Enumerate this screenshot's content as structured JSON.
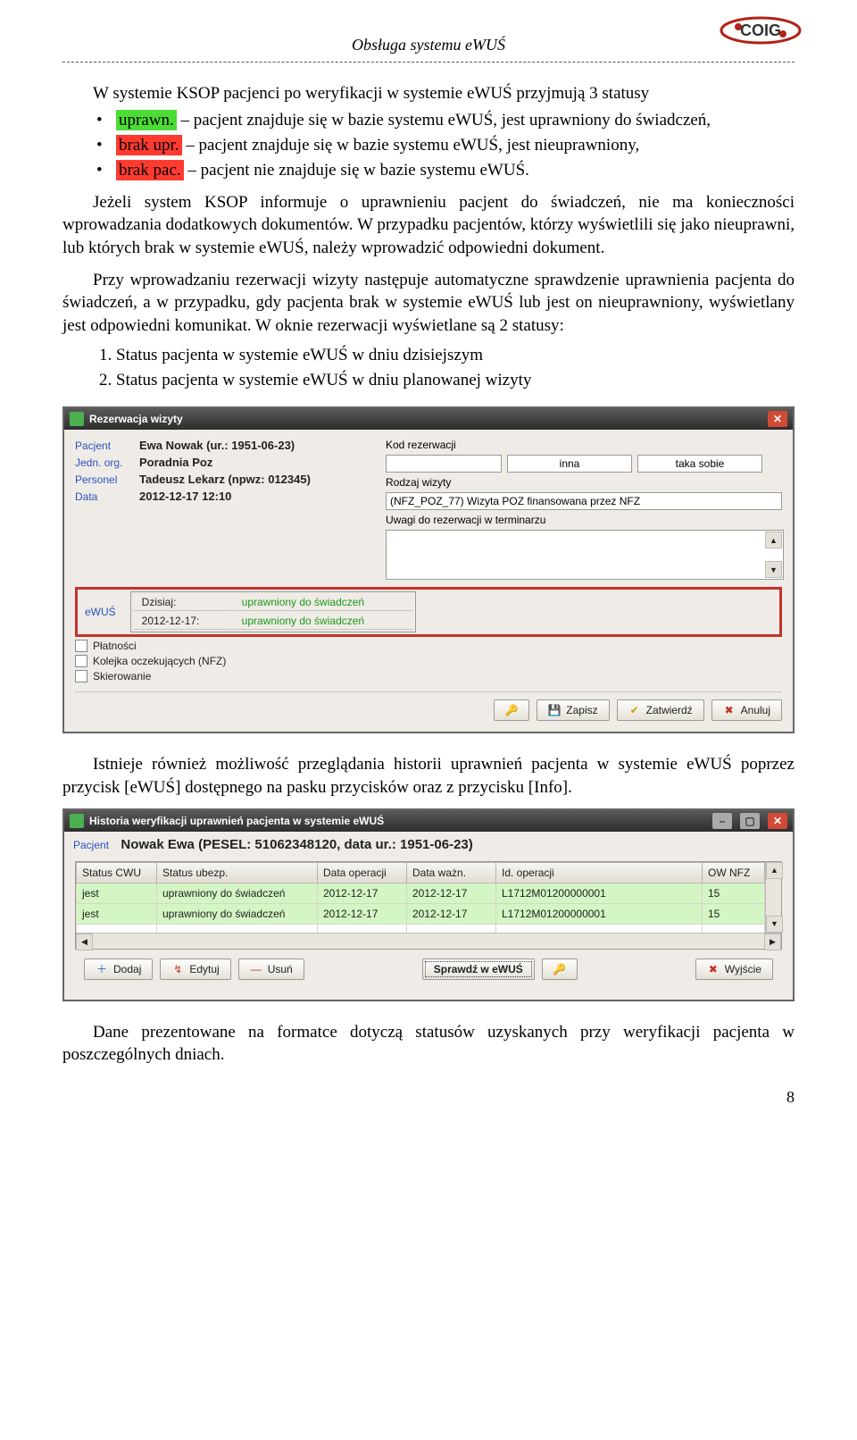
{
  "header": {
    "title": "Obsługa systemu eWUŚ",
    "logo_alt": "COIG"
  },
  "text": {
    "p1_a": "W systemie KSOP pacjenci po weryfikacji w systemie eWUŚ przyjmują 3 statusy",
    "b1_tag": "uprawn.",
    "b1_rest": " – pacjent znajduje się w bazie systemu eWUŚ, jest uprawniony do świadczeń,",
    "b2_tag": "brak upr.",
    "b2_rest": " – pacjent znajduje się w bazie systemu eWUŚ, jest nieuprawniony,",
    "b3_tag": "brak pac.",
    "b3_rest": " – pacjent nie znajduje się w bazie systemu eWUŚ.",
    "p2": "Jeżeli system KSOP informuje o uprawnieniu pacjent do świadczeń, nie ma konieczności wprowadzania dodatkowych dokumentów. W przypadku pacjentów, którzy wyświetlili się jako nieuprawni, lub których brak w systemie eWUŚ, należy wprowadzić odpowiedni dokument.",
    "p3": "Przy wprowadzaniu rezerwacji wizyty następuje automatyczne sprawdzenie uprawnienia pacjenta do świadczeń, a w przypadku, gdy pacjenta brak w systemie eWUŚ lub jest on nieuprawniony, wyświetlany jest odpowiedni komunikat. W oknie rezerwacji wyświetlane są 2 statusy:",
    "n1": "Status pacjenta w systemie eWUŚ w dniu dzisiejszym",
    "n2": "Status pacjenta w systemie eWUŚ w dniu planowanej wizyty",
    "p4": "Istnieje również możliwość przeglądania historii uprawnień pacjenta w systemie eWUŚ poprzez przycisk [eWUŚ] dostępnego na pasku przycisków oraz z przycisku [Info].",
    "p5": "Dane prezentowane na formatce dotyczą statusów uzyskanych przy weryfikacji pacjenta w poszczególnych dniach.",
    "pagenum": "8"
  },
  "win1": {
    "title": "Rezerwacja wizyty",
    "left": {
      "lbl_pacjent": "Pacjent",
      "val_pacjent": "Ewa Nowak (ur.: 1951-06-23)",
      "lbl_jedn": "Jedn. org.",
      "val_jedn": "Poradnia Poz",
      "lbl_personel": "Personel",
      "val_personel": "Tadeusz Lekarz (npwz: 012345)",
      "lbl_data": "Data",
      "val_data": "2012-12-17 12:10"
    },
    "right": {
      "lbl_kod": "Kod rezerwacji",
      "kod_val": "",
      "inna_val": "inna",
      "taka_val": "taka sobie",
      "lbl_rodzaj": "Rodzaj wizyty",
      "rodzaj_val": "(NFZ_POZ_77) Wizyta POZ finansowana przez NFZ",
      "lbl_uwagi": "Uwagi do rezerwacji w terminarzu"
    },
    "ewus": {
      "label": "eWUŚ",
      "row1_l": "Dzisiaj:",
      "row1_v": "uprawniony do świadczeń",
      "row2_l": "2012-12-17:",
      "row2_v": "uprawniony do świadczeń"
    },
    "chk": {
      "platnosci": "Płatności",
      "kolejka": "Kolejka oczekujących (NFZ)",
      "skierowanie": "Skierowanie"
    },
    "btn": {
      "zapisz": "Zapisz",
      "zatwierdz": "Zatwierdź",
      "anuluj": "Anuluj"
    }
  },
  "win2": {
    "title": "Historia weryfikacji uprawnień pacjenta w systemie eWUŚ",
    "lbl_pacjent": "Pacjent",
    "val_pacjent": "Nowak Ewa   (PESEL: 51062348120, data ur.: 1951-06-23)",
    "cols": {
      "c1": "Status CWU",
      "c2": "Status ubezp.",
      "c3": "Data operacji",
      "c4": "Data ważn.",
      "c5": "Id. operacji",
      "c6": "OW NFZ"
    },
    "rows": [
      {
        "c1": "jest",
        "c2": "uprawniony do świadczeń",
        "c3": "2012-12-17",
        "c4": "2012-12-17",
        "c5": "L1712M01200000001",
        "c6": "15"
      },
      {
        "c1": "jest",
        "c2": "uprawniony do świadczeń",
        "c3": "2012-12-17",
        "c4": "2012-12-17",
        "c5": "L1712M01200000001",
        "c6": "15"
      }
    ],
    "btn": {
      "dodaj": "Dodaj",
      "edytuj": "Edytuj",
      "usun": "Usuń",
      "sprawdz": "Sprawdź w eWUŚ",
      "wyjscie": "Wyjście"
    }
  }
}
